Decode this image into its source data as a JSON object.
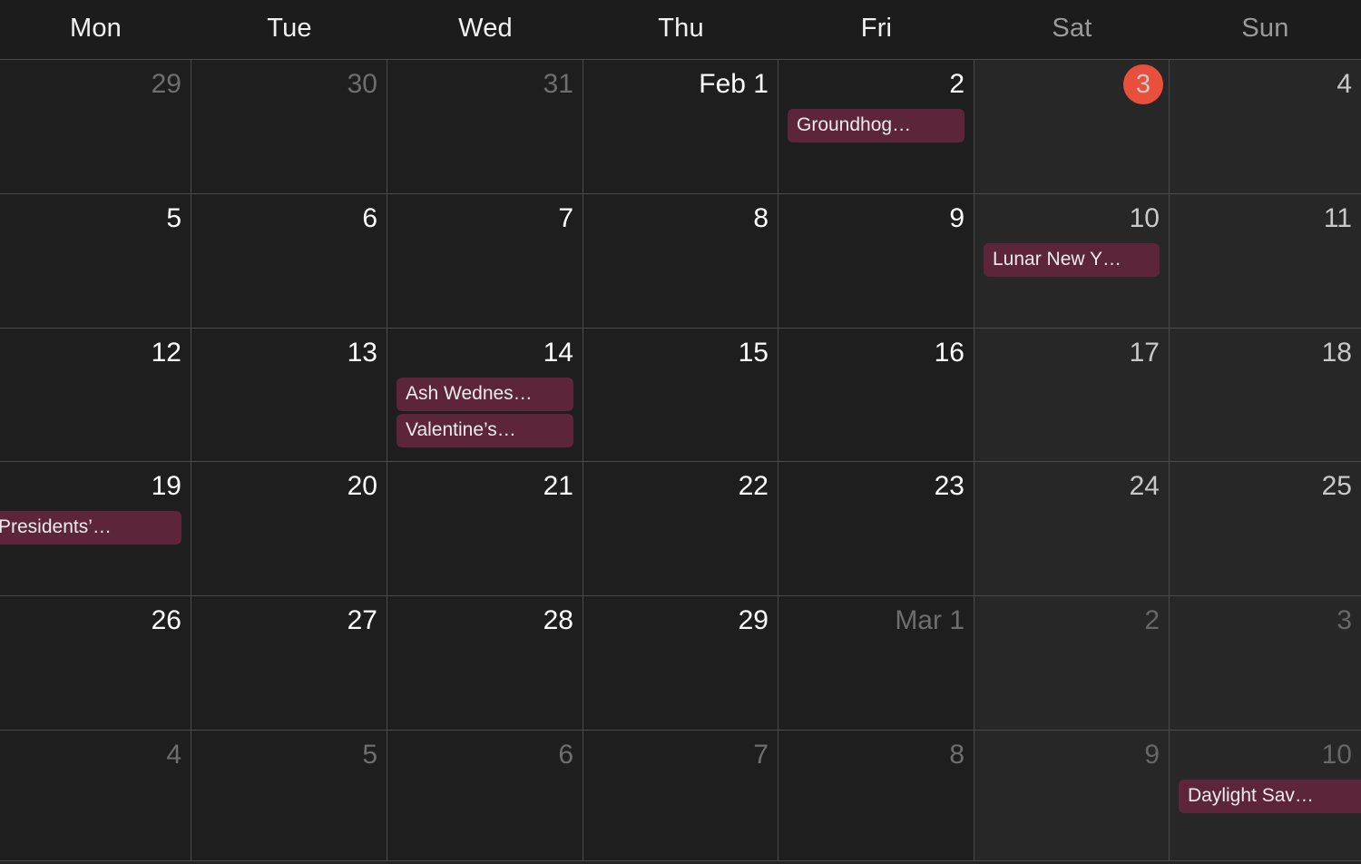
{
  "view": {
    "type": "month-grid",
    "theme": "dark",
    "colors": {
      "background": "#1c1c1c",
      "weekday_cell": "#1e1e1e",
      "weekend_cell": "#272727",
      "grid_line": "#4a4a4a",
      "event_pill": "#5d2539",
      "event_text": "#ececec",
      "today_accent": "#e8503c",
      "day_number": "#ffffff",
      "day_number_outside": "#6e6e6e"
    }
  },
  "header": {
    "weekdays": [
      {
        "label": "Mon",
        "weekend": false
      },
      {
        "label": "Tue",
        "weekend": false
      },
      {
        "label": "Wed",
        "weekend": false
      },
      {
        "label": "Thu",
        "weekend": false
      },
      {
        "label": "Fri",
        "weekend": false
      },
      {
        "label": "Sat",
        "weekend": true
      },
      {
        "label": "Sun",
        "weekend": true
      }
    ]
  },
  "weeks": [
    {
      "days": [
        {
          "label": "29",
          "outside": true,
          "weekend": false,
          "today": false,
          "events": []
        },
        {
          "label": "30",
          "outside": true,
          "weekend": false,
          "today": false,
          "events": []
        },
        {
          "label": "31",
          "outside": true,
          "weekend": false,
          "today": false,
          "events": []
        },
        {
          "label": "Feb 1",
          "outside": false,
          "weekend": false,
          "today": false,
          "events": []
        },
        {
          "label": "2",
          "outside": false,
          "weekend": false,
          "today": false,
          "events": [
            {
              "title": "Groundhog…"
            }
          ]
        },
        {
          "label": "3",
          "outside": false,
          "weekend": true,
          "today": true,
          "events": []
        },
        {
          "label": "4",
          "outside": false,
          "weekend": true,
          "today": false,
          "events": []
        }
      ]
    },
    {
      "days": [
        {
          "label": "5",
          "outside": false,
          "weekend": false,
          "today": false,
          "events": []
        },
        {
          "label": "6",
          "outside": false,
          "weekend": false,
          "today": false,
          "events": []
        },
        {
          "label": "7",
          "outside": false,
          "weekend": false,
          "today": false,
          "events": []
        },
        {
          "label": "8",
          "outside": false,
          "weekend": false,
          "today": false,
          "events": []
        },
        {
          "label": "9",
          "outside": false,
          "weekend": false,
          "today": false,
          "events": []
        },
        {
          "label": "10",
          "outside": false,
          "weekend": true,
          "today": false,
          "events": [
            {
              "title": "Lunar New Y…"
            }
          ]
        },
        {
          "label": "11",
          "outside": false,
          "weekend": true,
          "today": false,
          "events": []
        }
      ]
    },
    {
      "days": [
        {
          "label": "12",
          "outside": false,
          "weekend": false,
          "today": false,
          "events": []
        },
        {
          "label": "13",
          "outside": false,
          "weekend": false,
          "today": false,
          "events": []
        },
        {
          "label": "14",
          "outside": false,
          "weekend": false,
          "today": false,
          "events": [
            {
              "title": "Ash Wednes…"
            },
            {
              "title": "Valentine’s…"
            }
          ]
        },
        {
          "label": "15",
          "outside": false,
          "weekend": false,
          "today": false,
          "events": []
        },
        {
          "label": "16",
          "outside": false,
          "weekend": false,
          "today": false,
          "events": []
        },
        {
          "label": "17",
          "outside": false,
          "weekend": true,
          "today": false,
          "events": []
        },
        {
          "label": "18",
          "outside": false,
          "weekend": true,
          "today": false,
          "events": []
        }
      ]
    },
    {
      "days": [
        {
          "label": "19",
          "outside": false,
          "weekend": false,
          "today": false,
          "events": [
            {
              "title": "Presidents’…"
            }
          ]
        },
        {
          "label": "20",
          "outside": false,
          "weekend": false,
          "today": false,
          "events": []
        },
        {
          "label": "21",
          "outside": false,
          "weekend": false,
          "today": false,
          "events": []
        },
        {
          "label": "22",
          "outside": false,
          "weekend": false,
          "today": false,
          "events": []
        },
        {
          "label": "23",
          "outside": false,
          "weekend": false,
          "today": false,
          "events": []
        },
        {
          "label": "24",
          "outside": false,
          "weekend": true,
          "today": false,
          "events": []
        },
        {
          "label": "25",
          "outside": false,
          "weekend": true,
          "today": false,
          "events": []
        }
      ]
    },
    {
      "days": [
        {
          "label": "26",
          "outside": false,
          "weekend": false,
          "today": false,
          "events": []
        },
        {
          "label": "27",
          "outside": false,
          "weekend": false,
          "today": false,
          "events": []
        },
        {
          "label": "28",
          "outside": false,
          "weekend": false,
          "today": false,
          "events": []
        },
        {
          "label": "29",
          "outside": false,
          "weekend": false,
          "today": false,
          "events": []
        },
        {
          "label": "Mar 1",
          "outside": true,
          "weekend": false,
          "today": false,
          "events": []
        },
        {
          "label": "2",
          "outside": true,
          "weekend": true,
          "today": false,
          "events": []
        },
        {
          "label": "3",
          "outside": true,
          "weekend": true,
          "today": false,
          "events": []
        }
      ]
    },
    {
      "days": [
        {
          "label": "4",
          "outside": true,
          "weekend": false,
          "today": false,
          "events": []
        },
        {
          "label": "5",
          "outside": true,
          "weekend": false,
          "today": false,
          "events": []
        },
        {
          "label": "6",
          "outside": true,
          "weekend": false,
          "today": false,
          "events": []
        },
        {
          "label": "7",
          "outside": true,
          "weekend": false,
          "today": false,
          "events": []
        },
        {
          "label": "8",
          "outside": true,
          "weekend": false,
          "today": false,
          "events": []
        },
        {
          "label": "9",
          "outside": true,
          "weekend": true,
          "today": false,
          "events": []
        },
        {
          "label": "10",
          "outside": true,
          "weekend": true,
          "today": false,
          "events": [
            {
              "title": "Daylight Sav…"
            }
          ]
        }
      ]
    }
  ]
}
